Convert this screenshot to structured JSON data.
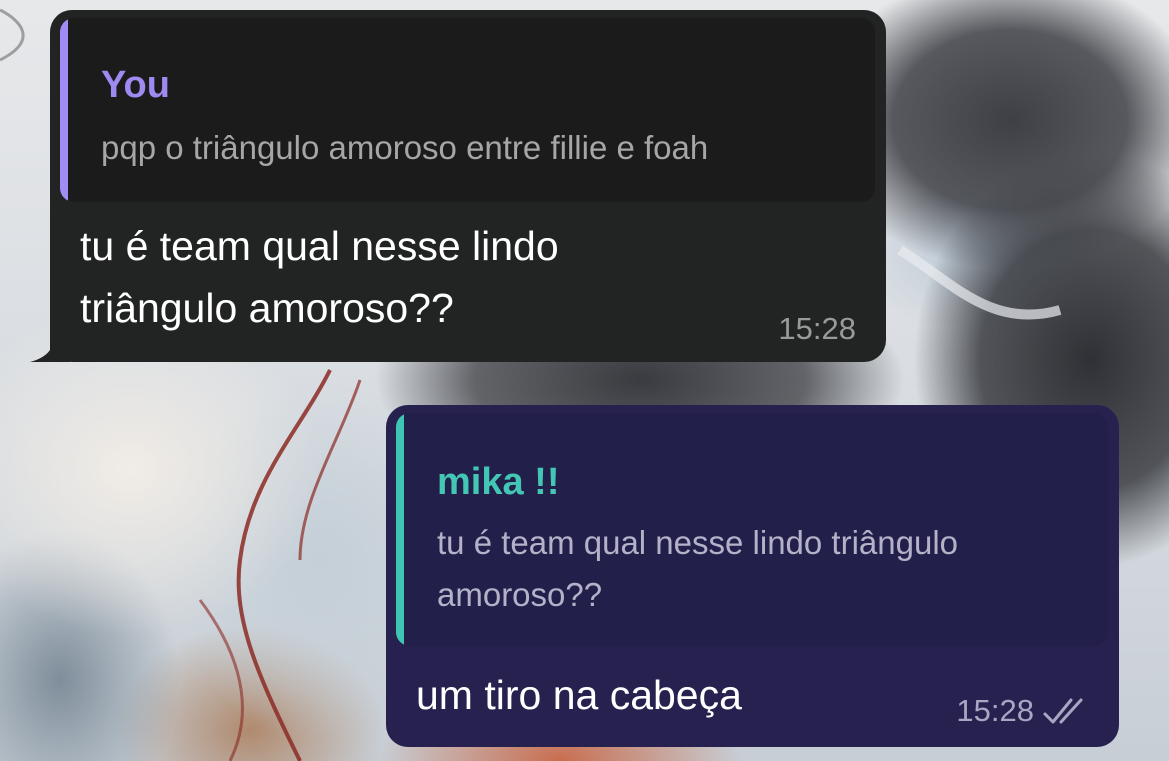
{
  "conversation": {
    "incoming": {
      "reply": {
        "sender": "You",
        "text": "pqp o triângulo amoroso entre fillie e foah"
      },
      "text_line1": "tu é team qual nesse lindo",
      "text_line2": "triângulo amoroso??",
      "time": "15:28"
    },
    "outgoing": {
      "reply": {
        "sender": "mika !!",
        "text_line1": "tu é team qual nesse lindo triângulo",
        "text_line2": "amoroso??"
      },
      "text": "um tiro na cabeça",
      "time": "15:28",
      "status_icon": "double-check-read-icon"
    }
  },
  "colors": {
    "incoming_bubble": "#222323",
    "outgoing_bubble": "#27214f",
    "incoming_quote_accent": "#a08cf3",
    "outgoing_quote_accent": "#3fc5b3"
  }
}
